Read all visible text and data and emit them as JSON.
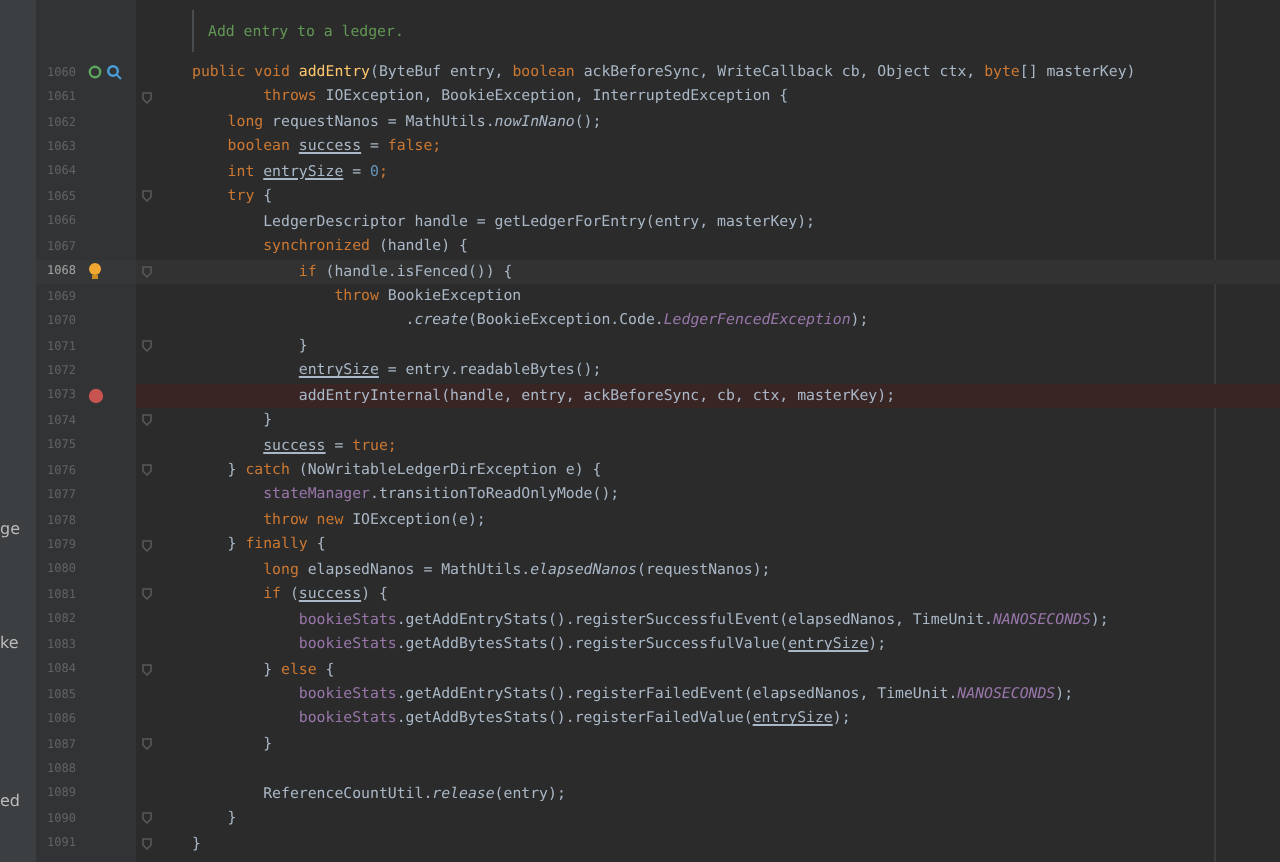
{
  "sidebar": {
    "items": [
      "ge",
      "ke",
      "ed"
    ]
  },
  "doc_comment": "Add entry to a ledger.",
  "lines": [
    {
      "number": "1060",
      "icons": [
        {
          "kind": "override"
        },
        {
          "kind": "implemented"
        }
      ],
      "tokens": [
        {
          "kind": "kw",
          "text": "public void "
        },
        {
          "kind": "decl",
          "text": "addEntry"
        },
        {
          "kind": "plain",
          "text": "(ByteBuf entry, "
        },
        {
          "kind": "kw",
          "text": "boolean "
        },
        {
          "kind": "plain",
          "text": "ackBeforeSync, WriteCallback cb, Object ctx, "
        },
        {
          "kind": "kw",
          "text": "byte"
        },
        {
          "kind": "plain",
          "text": "[] masterKey)"
        }
      ]
    },
    {
      "number": "1061",
      "fold": true,
      "tokens": [
        {
          "kind": "kw",
          "text": "        throws "
        },
        {
          "kind": "plain",
          "text": "IOException, BookieException, InterruptedException {"
        }
      ]
    },
    {
      "number": "1062",
      "tokens": [
        {
          "kind": "kw",
          "text": "    long "
        },
        {
          "kind": "plain",
          "text": "requestNanos = MathUtils."
        },
        {
          "kind": "ital",
          "text": "nowInNano"
        },
        {
          "kind": "plain",
          "text": "();"
        }
      ]
    },
    {
      "number": "1063",
      "tokens": [
        {
          "kind": "kw",
          "text": "    boolean "
        },
        {
          "kind": "var",
          "text": "success"
        },
        {
          "kind": "plain",
          "text": " = "
        },
        {
          "kind": "kw",
          "text": "false;"
        }
      ]
    },
    {
      "number": "1064",
      "tokens": [
        {
          "kind": "kw",
          "text": "    int "
        },
        {
          "kind": "var",
          "text": "entrySize"
        },
        {
          "kind": "plain",
          "text": " = "
        },
        {
          "kind": "num",
          "text": "0"
        },
        {
          "kind": "kw",
          "text": ";"
        }
      ]
    },
    {
      "number": "1065",
      "fold": true,
      "tokens": [
        {
          "kind": "kw",
          "text": "    try "
        },
        {
          "kind": "plain",
          "text": "{"
        }
      ]
    },
    {
      "number": "1066",
      "tokens": [
        {
          "kind": "plain",
          "text": "        LedgerDescriptor handle = getLedgerForEntry(entry, masterKey);"
        }
      ]
    },
    {
      "number": "1067",
      "tokens": [
        {
          "kind": "kw",
          "text": "        synchronized "
        },
        {
          "kind": "plain",
          "text": "(handle) {"
        }
      ]
    },
    {
      "number": "1068",
      "current": true,
      "fold": true,
      "icons": [
        {
          "kind": "bulb"
        }
      ],
      "tokens": [
        {
          "kind": "kw",
          "text": "            if "
        },
        {
          "kind": "plain",
          "text": "(handle.isFenced()) {"
        }
      ]
    },
    {
      "number": "1069",
      "tokens": [
        {
          "kind": "kw",
          "text": "                throw "
        },
        {
          "kind": "plain",
          "text": "BookieException"
        }
      ]
    },
    {
      "number": "1070",
      "tokens": [
        {
          "kind": "plain",
          "text": "                        ."
        },
        {
          "kind": "ital",
          "text": "create"
        },
        {
          "kind": "plain",
          "text": "(BookieException.Code."
        },
        {
          "kind": "const",
          "text": "LedgerFencedException"
        },
        {
          "kind": "plain",
          "text": ");"
        }
      ]
    },
    {
      "number": "1071",
      "fold": true,
      "tokens": [
        {
          "kind": "plain",
          "text": "            }"
        }
      ]
    },
    {
      "number": "1072",
      "tokens": [
        {
          "kind": "var",
          "text": "            entrySize"
        },
        {
          "kind": "plain",
          "text": " = entry.readableBytes();"
        }
      ]
    },
    {
      "number": "1073",
      "breakpoint": true,
      "tokens": [
        {
          "kind": "plain",
          "text": "            addEntryInternal(handle, entry, ackBeforeSync, cb, ctx, masterKey);"
        }
      ]
    },
    {
      "number": "1074",
      "fold": true,
      "tokens": [
        {
          "kind": "plain",
          "text": "        }"
        }
      ]
    },
    {
      "number": "1075",
      "tokens": [
        {
          "kind": "var",
          "text": "        success"
        },
        {
          "kind": "plain",
          "text": " = "
        },
        {
          "kind": "kw",
          "text": "true;"
        }
      ]
    },
    {
      "number": "1076",
      "fold": true,
      "tokens": [
        {
          "kind": "plain",
          "text": "    } "
        },
        {
          "kind": "kw",
          "text": "catch "
        },
        {
          "kind": "plain",
          "text": "(NoWritableLedgerDirException e) {"
        }
      ]
    },
    {
      "number": "1077",
      "tokens": [
        {
          "kind": "field",
          "text": "        stateManager"
        },
        {
          "kind": "plain",
          "text": ".transitionToReadOnlyMode();"
        }
      ]
    },
    {
      "number": "1078",
      "tokens": [
        {
          "kind": "kw",
          "text": "        throw new "
        },
        {
          "kind": "plain",
          "text": "IOException(e);"
        }
      ]
    },
    {
      "number": "1079",
      "fold": true,
      "tokens": [
        {
          "kind": "plain",
          "text": "    } "
        },
        {
          "kind": "kw",
          "text": "finally "
        },
        {
          "kind": "plain",
          "text": "{"
        }
      ]
    },
    {
      "number": "1080",
      "tokens": [
        {
          "kind": "kw",
          "text": "        long "
        },
        {
          "kind": "plain",
          "text": "elapsedNanos = MathUtils."
        },
        {
          "kind": "ital",
          "text": "elapsedNanos"
        },
        {
          "kind": "plain",
          "text": "(requestNanos);"
        }
      ]
    },
    {
      "number": "1081",
      "fold": true,
      "tokens": [
        {
          "kind": "kw",
          "text": "        if "
        },
        {
          "kind": "plain",
          "text": "("
        },
        {
          "kind": "var",
          "text": "success"
        },
        {
          "kind": "plain",
          "text": ") {"
        }
      ]
    },
    {
      "number": "1082",
      "tokens": [
        {
          "kind": "field",
          "text": "            bookieStats"
        },
        {
          "kind": "plain",
          "text": ".getAddEntryStats().registerSuccessfulEvent(elapsedNanos, TimeUnit."
        },
        {
          "kind": "const",
          "text": "NANOSECONDS"
        },
        {
          "kind": "plain",
          "text": ");"
        }
      ]
    },
    {
      "number": "1083",
      "tokens": [
        {
          "kind": "field",
          "text": "            bookieStats"
        },
        {
          "kind": "plain",
          "text": ".getAddBytesStats().registerSuccessfulValue("
        },
        {
          "kind": "var",
          "text": "entrySize"
        },
        {
          "kind": "plain",
          "text": ");"
        }
      ]
    },
    {
      "number": "1084",
      "fold": true,
      "tokens": [
        {
          "kind": "plain",
          "text": "        } "
        },
        {
          "kind": "kw",
          "text": "else "
        },
        {
          "kind": "plain",
          "text": "{"
        }
      ]
    },
    {
      "number": "1085",
      "tokens": [
        {
          "kind": "field",
          "text": "            bookieStats"
        },
        {
          "kind": "plain",
          "text": ".getAddEntryStats().registerFailedEvent(elapsedNanos, TimeUnit."
        },
        {
          "kind": "const",
          "text": "NANOSECONDS"
        },
        {
          "kind": "plain",
          "text": ");"
        }
      ]
    },
    {
      "number": "1086",
      "tokens": [
        {
          "kind": "field",
          "text": "            bookieStats"
        },
        {
          "kind": "plain",
          "text": ".getAddBytesStats().registerFailedValue("
        },
        {
          "kind": "var",
          "text": "entrySize"
        },
        {
          "kind": "plain",
          "text": ");"
        }
      ]
    },
    {
      "number": "1087",
      "fold": true,
      "tokens": [
        {
          "kind": "plain",
          "text": "        }"
        }
      ]
    },
    {
      "number": "1088"
    },
    {
      "number": "1089",
      "tokens": [
        {
          "kind": "plain",
          "text": "        ReferenceCountUtil."
        },
        {
          "kind": "ital",
          "text": "release"
        },
        {
          "kind": "plain",
          "text": "(entry);"
        }
      ]
    },
    {
      "number": "1090",
      "fold": true,
      "tokens": [
        {
          "kind": "plain",
          "text": "    }"
        }
      ]
    },
    {
      "number": "1091",
      "fold": true,
      "tokens": [
        {
          "kind": "plain",
          "text": "}"
        }
      ]
    }
  ]
}
